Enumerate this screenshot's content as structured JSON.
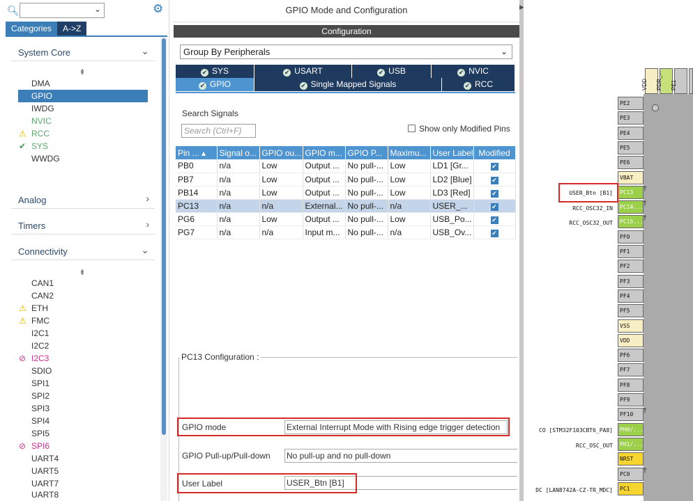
{
  "left": {
    "tabs": [
      "Categories",
      "A->Z"
    ],
    "sections": {
      "system_core": {
        "title": "System Core",
        "items": [
          "DMA",
          "GPIO",
          "IWDG",
          "NVIC",
          "RCC",
          "SYS",
          "WWDG"
        ]
      },
      "analog": {
        "title": "Analog"
      },
      "timers": {
        "title": "Timers"
      },
      "connectivity": {
        "title": "Connectivity",
        "items": [
          "CAN1",
          "CAN2",
          "ETH",
          "FMC",
          "I2C1",
          "I2C2",
          "I2C3",
          "SDIO",
          "SPI1",
          "SPI2",
          "SPI3",
          "SPI4",
          "SPI5",
          "SPI6",
          "UART4",
          "UART5",
          "UART7",
          "UART8"
        ]
      }
    },
    "icons": {
      "search": "search-icon",
      "settings": "gear-icon",
      "warning": "warning-icon",
      "check": "check-icon",
      "forbidden": "forbidden-icon"
    }
  },
  "middle": {
    "title": "GPIO Mode and Configuration",
    "config_bar": "Configuration",
    "group_select": "Group By Peripherals",
    "tabs_row1": [
      "SYS",
      "USART",
      "USB",
      "NVIC"
    ],
    "tabs_row2": [
      "GPIO",
      "Single Mapped Signals",
      "RCC"
    ],
    "search_label": "Search Signals",
    "search_placeholder": "Search (Ctrl+F)",
    "show_modified": "Show only Modified Pins",
    "table": {
      "headers": [
        "Pin ...",
        "Signal o...",
        "GPIO ou...",
        "GPIO m...",
        "GPIO P...",
        "Maximu...",
        "User Label",
        "Modified"
      ],
      "rows": [
        [
          "PB0",
          "n/a",
          "Low",
          "Output ...",
          "No pull-...",
          "Low",
          "LD1 [Gr...",
          true
        ],
        [
          "PB7",
          "n/a",
          "Low",
          "Output ...",
          "No pull-...",
          "Low",
          "LD2 [Blue]",
          true
        ],
        [
          "PB14",
          "n/a",
          "Low",
          "Output ...",
          "No pull-...",
          "Low",
          "LD3 [Red]",
          true
        ],
        [
          "PC13",
          "n/a",
          "n/a",
          "External...",
          "No pull-...",
          "n/a",
          "USER_...",
          true
        ],
        [
          "PG6",
          "n/a",
          "Low",
          "Output ...",
          "No pull-...",
          "Low",
          "USB_Po...",
          true
        ],
        [
          "PG7",
          "n/a",
          "n/a",
          "Input m...",
          "No pull-...",
          "n/a",
          "USB_Ov...",
          true
        ]
      ],
      "selected_row": 3
    },
    "pc13": {
      "title": "PC13 Configuration :",
      "gpio_mode_label": "GPIO mode",
      "gpio_mode_value": "External Interrupt Mode with Rising edge trigger detection",
      "pull_label": "GPIO Pull-up/Pull-down",
      "pull_value": "No pull-up and no pull-down",
      "user_label_label": "User Label",
      "user_label_value": "USER_Btn [B1]"
    }
  },
  "chip": {
    "top_pins": [
      "VDD",
      "PDR_...",
      "PE1"
    ],
    "pins": [
      "PE2",
      "PE3",
      "PE4",
      "PE5",
      "PE6",
      "VBAT",
      "PC13",
      "PC14...",
      "PC15...",
      "PF0",
      "PF1",
      "PF2",
      "PF3",
      "PF4",
      "PF5",
      "VSS",
      "VDD",
      "PF6",
      "PF7",
      "PF8",
      "PF9",
      "PF10",
      "PH0/...",
      "PH1/...",
      "NRST",
      "PC0",
      "PC1"
    ],
    "signal_labels": {
      "PC13": "USER_Btn [B1]",
      "PC14": "RCC_OSC32_IN",
      "PC15": "RCC_OSC32_OUT",
      "PH0": "CO [STM32F103CBT6_PA8]",
      "PH1": "RCC_OSC_OUT",
      "PC1": "DC [LAN8742A-CZ-TR_MDC]"
    },
    "colors": {
      "green": "#9ccf4a",
      "yellow": "#f8eec3",
      "gold": "#f5d52e",
      "gray": "#c9c9c9"
    }
  }
}
